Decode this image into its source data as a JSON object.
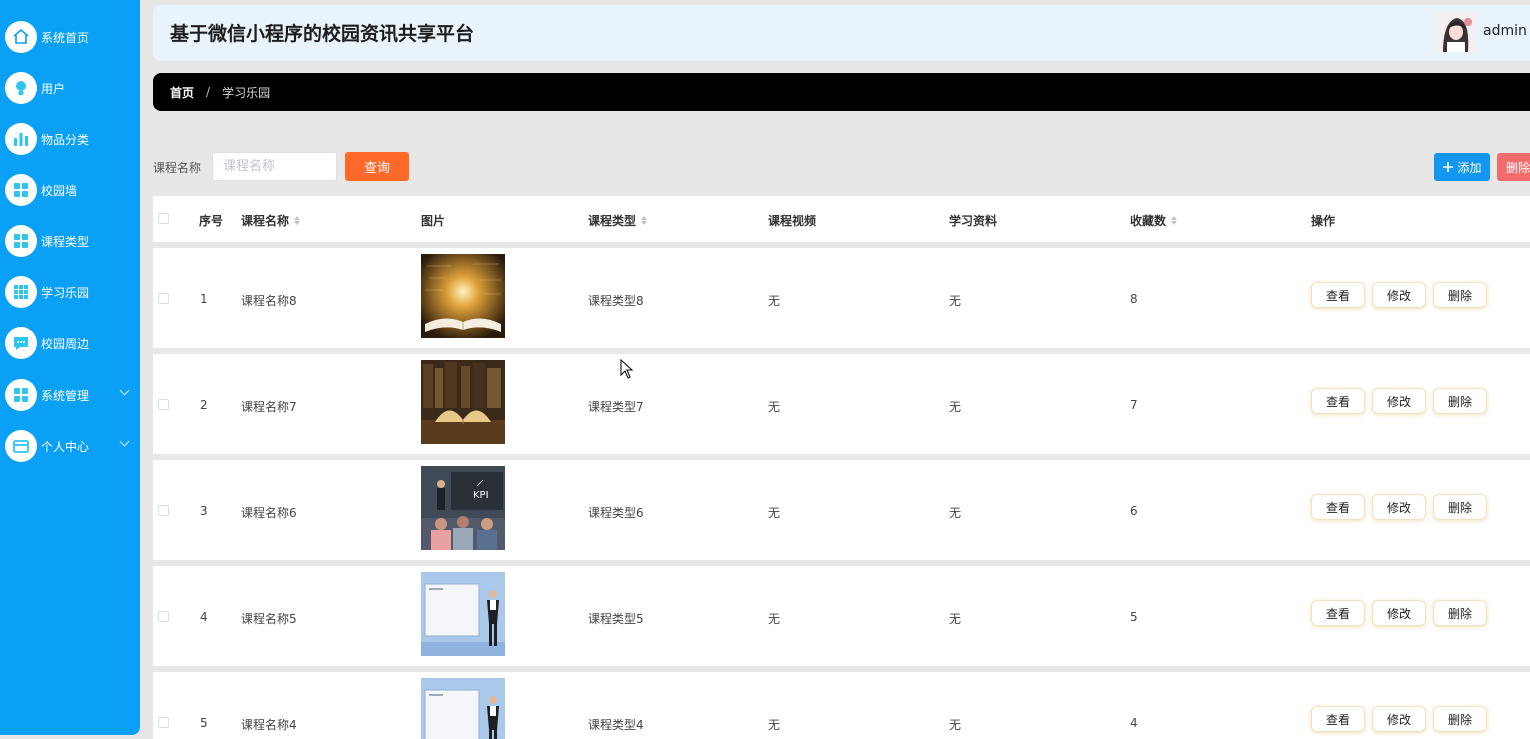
{
  "sidebar": {
    "items": [
      {
        "label": "系统首页",
        "icon": "home-icon"
      },
      {
        "label": "用户",
        "icon": "bulb-icon"
      },
      {
        "label": "物品分类",
        "icon": "bar-chart-icon"
      },
      {
        "label": "校园墙",
        "icon": "grid-icon"
      },
      {
        "label": "课程类型",
        "icon": "grid-icon"
      },
      {
        "label": "学习乐园",
        "icon": "apps-icon"
      },
      {
        "label": "校园周边",
        "icon": "chat-icon"
      },
      {
        "label": "系统管理",
        "icon": "grid-icon"
      },
      {
        "label": "个人中心",
        "icon": "card-icon"
      }
    ]
  },
  "header": {
    "title": "基于微信小程序的校园资讯共享平台",
    "user": "admin"
  },
  "breadcrumb": {
    "home": "首页",
    "separator": "/",
    "current": "学习乐园"
  },
  "search": {
    "label": "课程名称",
    "placeholder": "课程名称",
    "query_label": "查询",
    "add_label": "添加",
    "delete_label": "删除"
  },
  "table": {
    "columns": {
      "index": "序号",
      "name": "课程名称",
      "image": "图片",
      "type": "课程类型",
      "video": "课程视频",
      "material": "学习资料",
      "favorites": "收藏数",
      "actions": "操作"
    },
    "actions": {
      "view": "查看",
      "edit": "修改",
      "delete": "删除"
    },
    "rows": [
      {
        "index": "1",
        "name": "课程名称8",
        "type": "课程类型8",
        "video": "无",
        "material": "无",
        "favorites": "8",
        "image": "book-light"
      },
      {
        "index": "2",
        "name": "课程名称7",
        "type": "课程类型7",
        "video": "无",
        "material": "无",
        "favorites": "7",
        "image": "open-book-shelf"
      },
      {
        "index": "3",
        "name": "课程名称6",
        "type": "课程类型6",
        "video": "无",
        "material": "无",
        "favorites": "6",
        "image": "classroom-kpi"
      },
      {
        "index": "4",
        "name": "课程名称5",
        "type": "课程类型5",
        "video": "无",
        "material": "无",
        "favorites": "5",
        "image": "presenter-screen"
      },
      {
        "index": "5",
        "name": "课程名称4",
        "type": "课程类型4",
        "video": "无",
        "material": "无",
        "favorites": "4",
        "image": "presenter-screen"
      }
    ],
    "thumb_text": "KPI"
  },
  "colors": {
    "sidebar": "#0aa0f5",
    "query": "#ff6a2b",
    "add": "#1296ef",
    "delete": "#f26c6c"
  }
}
